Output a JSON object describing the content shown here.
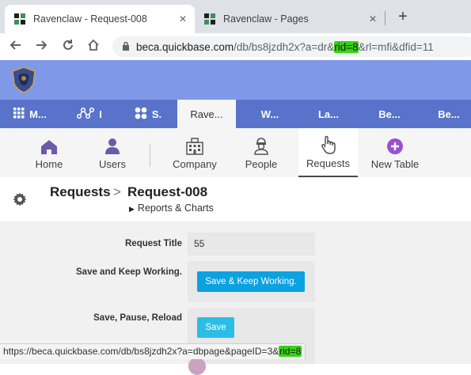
{
  "browser": {
    "tabs": [
      {
        "title": "Ravenclaw - Request-008",
        "active": true
      },
      {
        "title": "Ravenclaw - Pages",
        "active": false
      }
    ],
    "new_tab_icon": "plus-icon",
    "url_host": "beca.quickbase.com",
    "url_path_before": "/db/bs8jzdh2x?a=dr&",
    "url_highlight": "rid=8",
    "url_path_after": "&rl=mfi&dfid=11",
    "highlight_color": "#39d316"
  },
  "app": {
    "header_color": "#7f98e8",
    "tabs_color": "#5873c9",
    "tabs": [
      {
        "label": "M...",
        "icon": "grid-icon"
      },
      {
        "label": "I",
        "icon": "network-icon"
      },
      {
        "label": "S.",
        "icon": "dots-icon"
      },
      {
        "label": "Rave...",
        "active": true
      },
      {
        "label": "W..."
      },
      {
        "label": "La..."
      },
      {
        "label": "Be..."
      },
      {
        "label": "Be..."
      }
    ]
  },
  "tables": [
    {
      "label": "Home",
      "icon": "home-icon"
    },
    {
      "label": "Users",
      "icon": "user-icon"
    },
    {
      "label": "Company",
      "icon": "building-icon"
    },
    {
      "label": "People",
      "icon": "person-icon"
    },
    {
      "label": "Requests",
      "icon": "hand-pointer-icon",
      "active": true
    },
    {
      "label": "New Table",
      "icon": "plus-circle-icon"
    }
  ],
  "breadcrumb": {
    "table": "Requests",
    "separator": ">",
    "record": "Request-008",
    "reports_link": "Reports & Charts"
  },
  "form": {
    "fields": [
      {
        "label": "Request Title",
        "value": "55"
      },
      {
        "label": "Save and Keep Working.",
        "button": "Save & Keep Working."
      },
      {
        "label": "Save, Pause, Reload",
        "button": "Save"
      }
    ],
    "button_color": "#0ca1e0"
  },
  "status_bar": {
    "before": "https://beca.quickbase.com/db/bs8jzdh2x?a=dbpage&pageID=3&",
    "highlight": "rid=8"
  }
}
